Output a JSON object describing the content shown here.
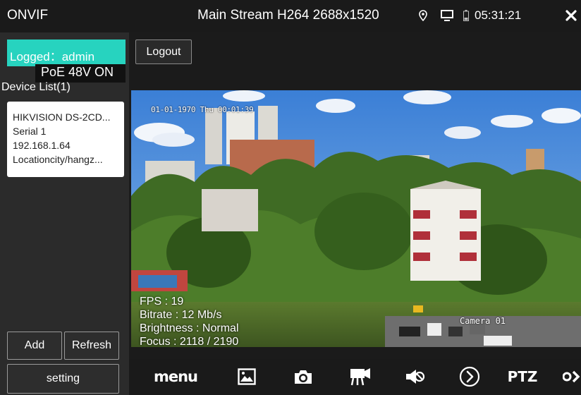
{
  "status_bar": {
    "app_title": "ONVIF",
    "stream_title": "Main Stream H264 2688x1520",
    "time": "05:31:21",
    "icons": [
      "location-pin-icon",
      "monitor-icon",
      "battery-icon",
      "close-icon"
    ]
  },
  "left_panel": {
    "logged_label": "Logged：admin",
    "poe_status": "PoE 48V ON",
    "device_list_title": "Device List(1)",
    "device": {
      "model": "HIKVISION DS-2CD...",
      "serial": "Serial 1",
      "ip": "192.168.1.64",
      "location": "Locationcity/hangz..."
    },
    "add_label": "Add",
    "refresh_label": "Refresh",
    "setting_label": "setting"
  },
  "main": {
    "logout_label": "Logout",
    "video": {
      "osd_datetime": "01-01-1970 Thu 00:01:39",
      "osd_camera": "Camera 01",
      "fps": "FPS : 19",
      "bitrate": "Bitrate : 12 Mb/s",
      "brightness": "Brightness : Normal",
      "focus": "Focus : 2118 / 2190"
    },
    "toolbar": {
      "menu_label": "menu",
      "ptz_label": "PTZ",
      "icons": [
        "image-icon",
        "camera-icon",
        "video-record-icon",
        "mute-icon",
        "play-circle-icon",
        "more-icon"
      ]
    }
  },
  "colors": {
    "accent": "#27d3bf",
    "background": "#1c1c1c",
    "panel": "#2b2b2b"
  }
}
